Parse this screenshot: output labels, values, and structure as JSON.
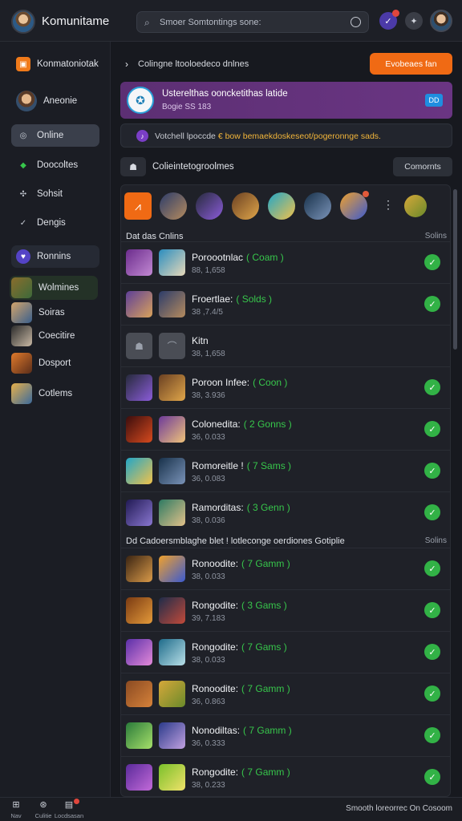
{
  "app": {
    "title": "Komunitame"
  },
  "search": {
    "placeholder": "Smoer Somtontings sone:"
  },
  "sidebar": {
    "items": [
      {
        "label": "Konmatoniotak"
      },
      {
        "label": "Aneonie"
      },
      {
        "label": "Online"
      },
      {
        "label": "Doocoltes"
      },
      {
        "label": "Sohsit"
      },
      {
        "label": "Dengis"
      },
      {
        "label": "Ronnins"
      },
      {
        "label": "Wolmines"
      },
      {
        "label": "Soiras"
      },
      {
        "label": "Coecitire"
      },
      {
        "label": "Dosport"
      },
      {
        "label": "Cotlems"
      }
    ]
  },
  "main": {
    "top_text": "Colingne ltooloedeco dnlnes",
    "top_button": "Evobeaes fan",
    "banner_title": "Usterelthas ooncketithas latide",
    "banner_sub": "Bogie SS 183",
    "banner_tag": "DD",
    "notice_a": "Votchell lpoccde",
    "notice_b": "€ bow bemaekdoskeseot/pogeronnge sads.",
    "section_label": "Colieintetogroolmes",
    "section_button": "Comornts"
  },
  "list1": {
    "title": "Dat das Cnlins",
    "right": "Solins"
  },
  "list2": {
    "title": "Dd Cadoersmblaghe blet ! lotleconge oerdiones  Gotiplie",
    "right": "Solins"
  },
  "friends": [
    {
      "name": "Poroootnlac",
      "status": "( Coam )",
      "sub": "88, 1,658",
      "online": true
    },
    {
      "name": "Froertlae:",
      "status": "( Solds )",
      "sub": "38 ,7.4/5",
      "online": true
    },
    {
      "name": "Kitn",
      "status": "",
      "sub": "38, 1,658",
      "online": false
    },
    {
      "name": "Poroon Infee:",
      "status": "( Coon )",
      "sub": "38, 3.936",
      "online": true
    },
    {
      "name": "Colonedita:",
      "status": "( 2 Gonns )",
      "sub": "36, 0.033",
      "online": true
    },
    {
      "name": "Romoreitle !",
      "status": "( 7 Sams )",
      "sub": "36, 0.083",
      "online": true
    },
    {
      "name": "Ramorditas:",
      "status": "( 3 Genn )",
      "sub": "38, 0.036",
      "online": true
    },
    {
      "name": "Ronoodite:",
      "status": "( 7 Gamm )",
      "sub": "38, 0.033",
      "online": true
    },
    {
      "name": "Rongodite:",
      "status": "( 3 Gams )",
      "sub": "39, 7.183",
      "online": true
    },
    {
      "name": "Rongodite:",
      "status": "( 7 Gams )",
      "sub": "38, 0.033",
      "online": true
    },
    {
      "name": "Ronoodite:",
      "status": "( 7 Gamm )",
      "sub": "36, 0.863",
      "online": true
    },
    {
      "name": "Nonodiltas:",
      "status": "( 7 Gamm )",
      "sub": "36, 0.333",
      "online": true
    },
    {
      "name": "Rongodite:",
      "status": "( 7 Gamm )",
      "sub": "38, 0.233",
      "online": true
    }
  ],
  "bottombar": {
    "items": [
      {
        "label": "Nav"
      },
      {
        "label": "Culitie"
      },
      {
        "label": "Locdsasan"
      }
    ],
    "right": "Smooth loreorrec  On  Cosoom"
  }
}
